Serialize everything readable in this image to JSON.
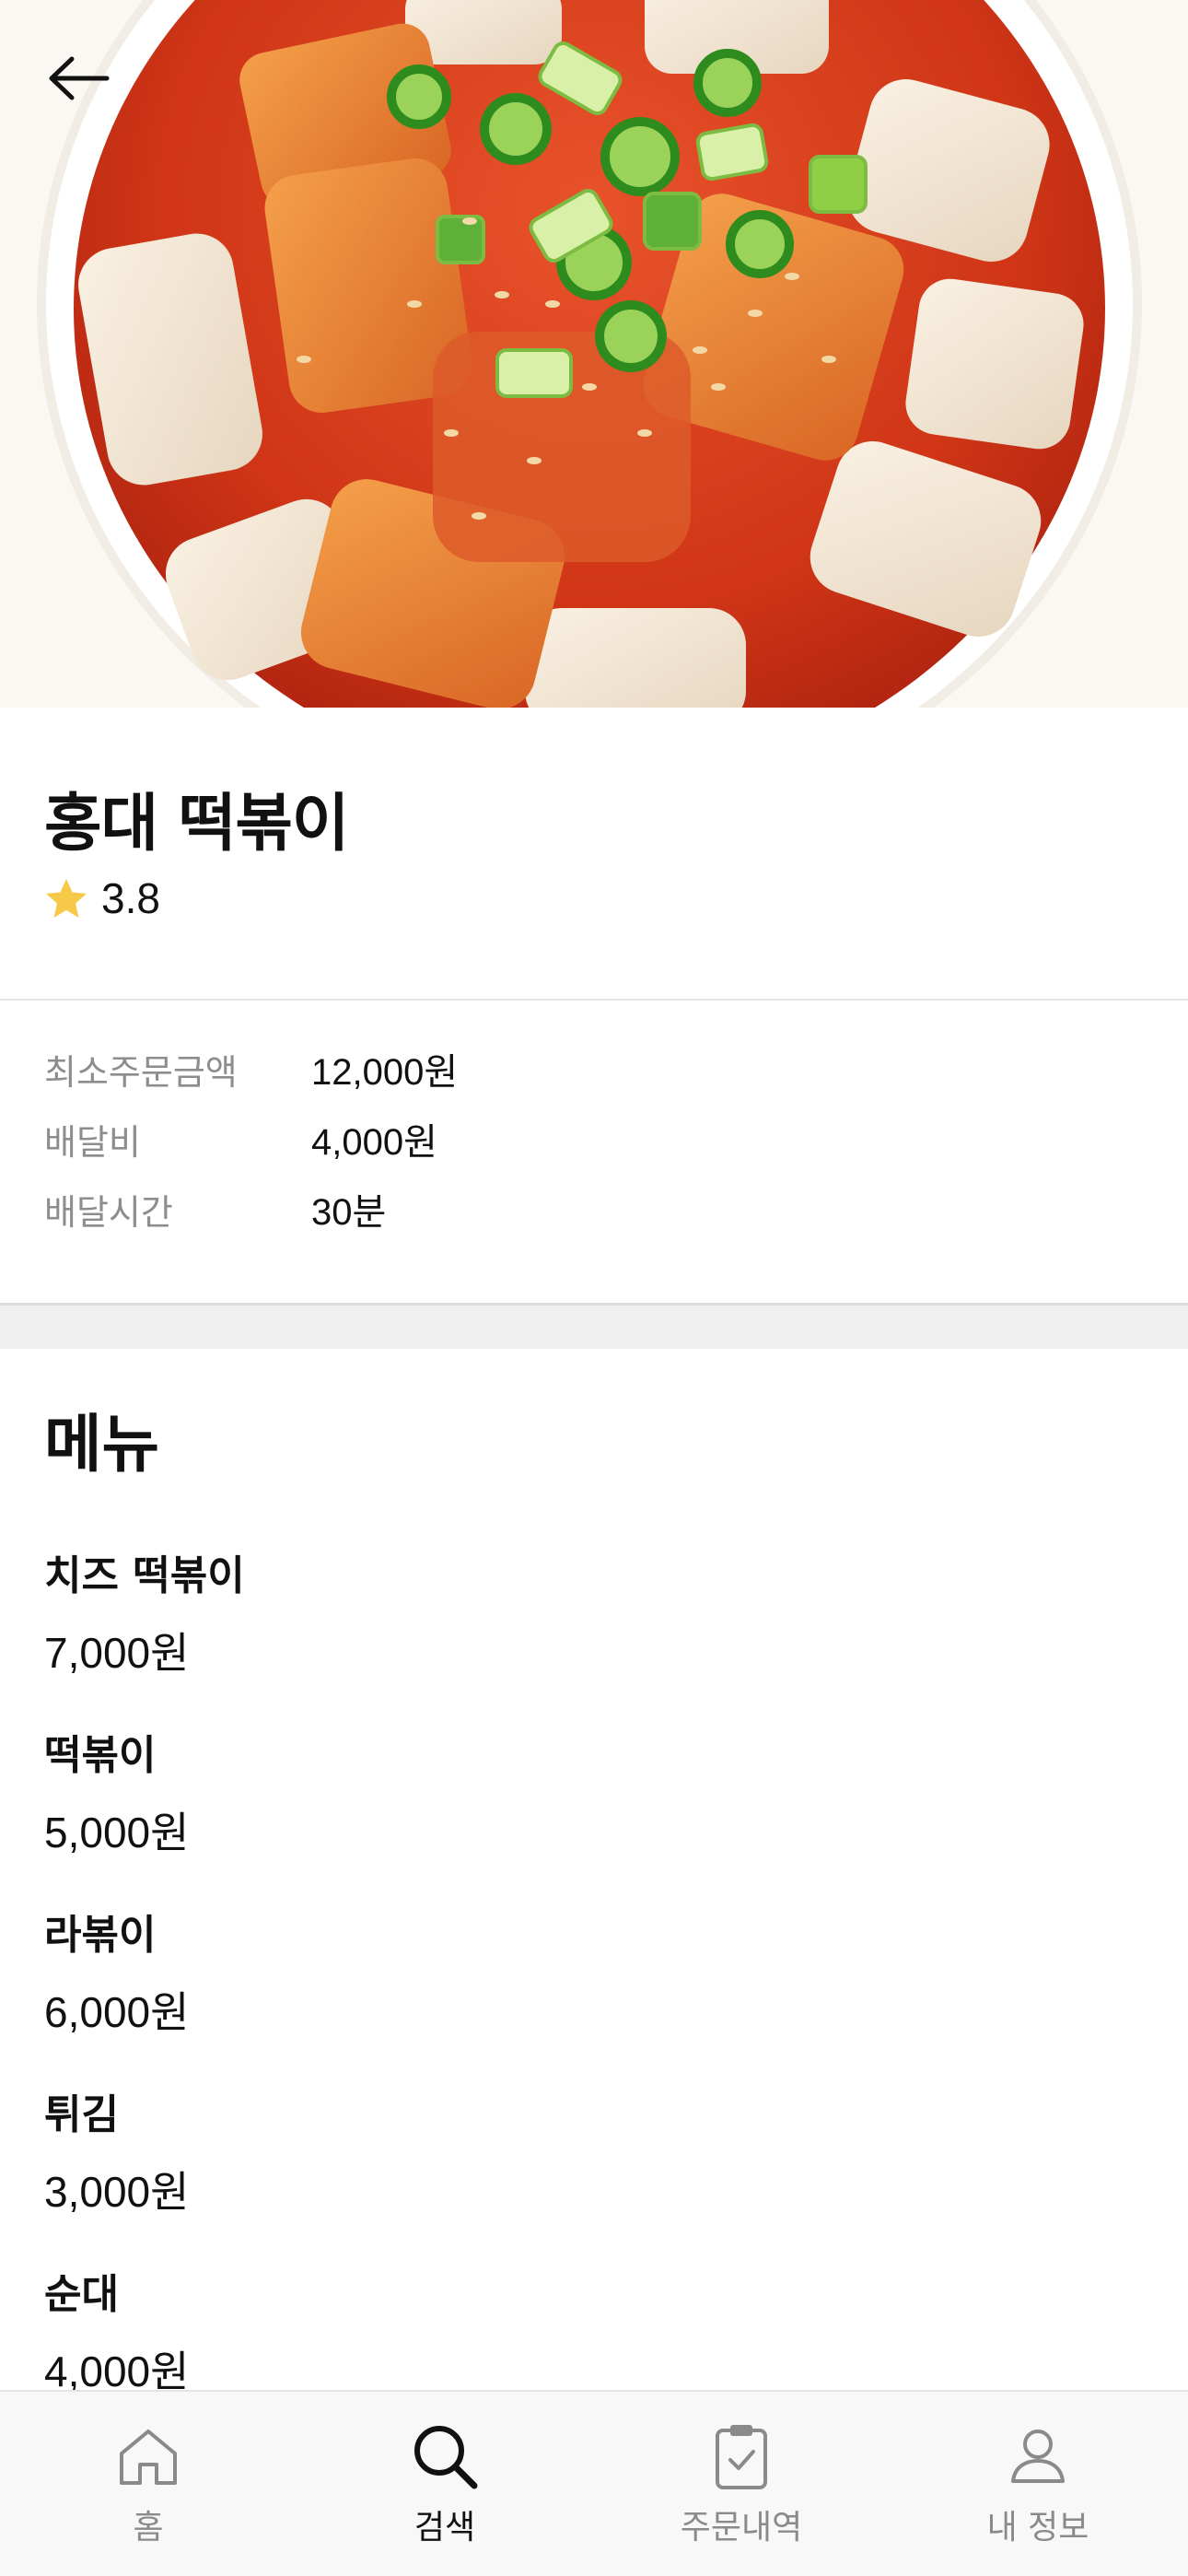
{
  "store": {
    "name": "홍대 떡볶이",
    "rating": "3.8"
  },
  "info": {
    "min_order_label": "최소주문금액",
    "min_order_value": "12,000원",
    "delivery_fee_label": "배달비",
    "delivery_fee_value": "4,000원",
    "delivery_time_label": "배달시간",
    "delivery_time_value": "30분"
  },
  "menu": {
    "title": "메뉴",
    "items": [
      {
        "name": "치즈 떡볶이",
        "price": "7,000원"
      },
      {
        "name": "떡볶이",
        "price": "5,000원"
      },
      {
        "name": "라볶이",
        "price": "6,000원"
      },
      {
        "name": "튀김",
        "price": "3,000원"
      },
      {
        "name": "순대",
        "price": "4,000원"
      }
    ]
  },
  "tabs": [
    {
      "label": "홈",
      "icon": "home-icon"
    },
    {
      "label": "검색",
      "icon": "search-icon",
      "active": true
    },
    {
      "label": "주문내역",
      "icon": "clipboard-check-icon"
    },
    {
      "label": "내 정보",
      "icon": "user-icon"
    }
  ],
  "colors": {
    "star": "#f7c948",
    "tab_inactive": "#8a8a8a",
    "tab_active": "#111111",
    "sauce": "#d9401e"
  }
}
